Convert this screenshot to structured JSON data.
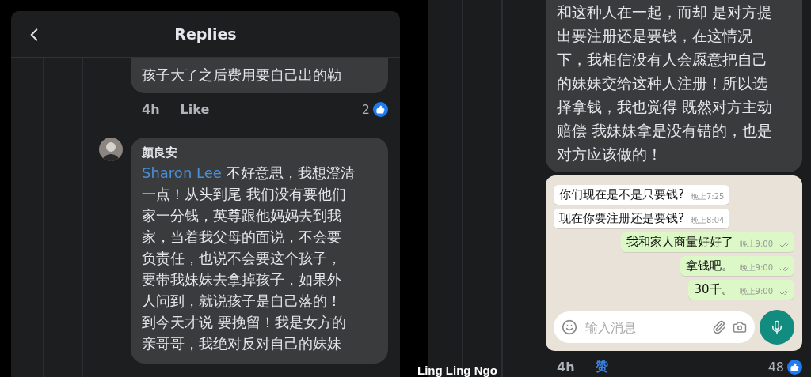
{
  "left_panel": {
    "header": {
      "title": "Replies"
    },
    "comments": [
      {
        "kind": "cut",
        "lines": [
          "孩子大了之后费用要自己出的勒"
        ],
        "meta": {
          "time": "4h",
          "like": "Like",
          "liked": false,
          "reactions": "2"
        }
      },
      {
        "kind": "full",
        "author": "颜良安",
        "mention": "Sharon Lee",
        "lines": [
          "不好意思，我想澄清",
          "一点！从头到尾 我们没有要他们",
          "家一分钱，英尊跟他妈妈去到我",
          "家，当着我父母的面说，不会要",
          "负责任，也说不会要这个孩子，",
          "要带我妹妹去拿掉孩子，如果外",
          "人问到，就说孩子是自己落的！",
          "到今天才说 要挽留！我是女方的",
          "亲哥哥，我绝对反对自己的妹妹"
        ]
      }
    ]
  },
  "right_panel": {
    "comment": {
      "lines": [
        "和这种人在一起，而却 是对方提",
        "出要注册还是要钱，在这情况",
        "下，我相信没有人会愿意把自己",
        "的妹妹交给这种人注册！所以选",
        "择拿钱，我也觉得 既然对方主动",
        "赔偿 我妹妹拿是没有错的，也是",
        "对方应该做的！"
      ],
      "attachment": {
        "kind": "chat",
        "messages": [
          {
            "text": "你们现在是不是只要钱?",
            "time": "晚上7:25",
            "outgoing": false
          },
          {
            "text": "现在你要注册还是要钱?",
            "time": "晚上8:04",
            "outgoing": false
          },
          {
            "text": "我和家人商量好好了",
            "time": "晚上9:00",
            "outgoing": true
          },
          {
            "text": "拿钱吧。",
            "time": "晚上9:00",
            "outgoing": true
          },
          {
            "text": "30千。",
            "time": "晚上9:00",
            "outgoing": true
          }
        ],
        "input": {
          "placeholder": "输入消息"
        }
      },
      "meta": {
        "time": "4h",
        "like": "赞",
        "liked": true,
        "reactions": "48"
      }
    }
  },
  "caption": "Ling Ling Ngo"
}
